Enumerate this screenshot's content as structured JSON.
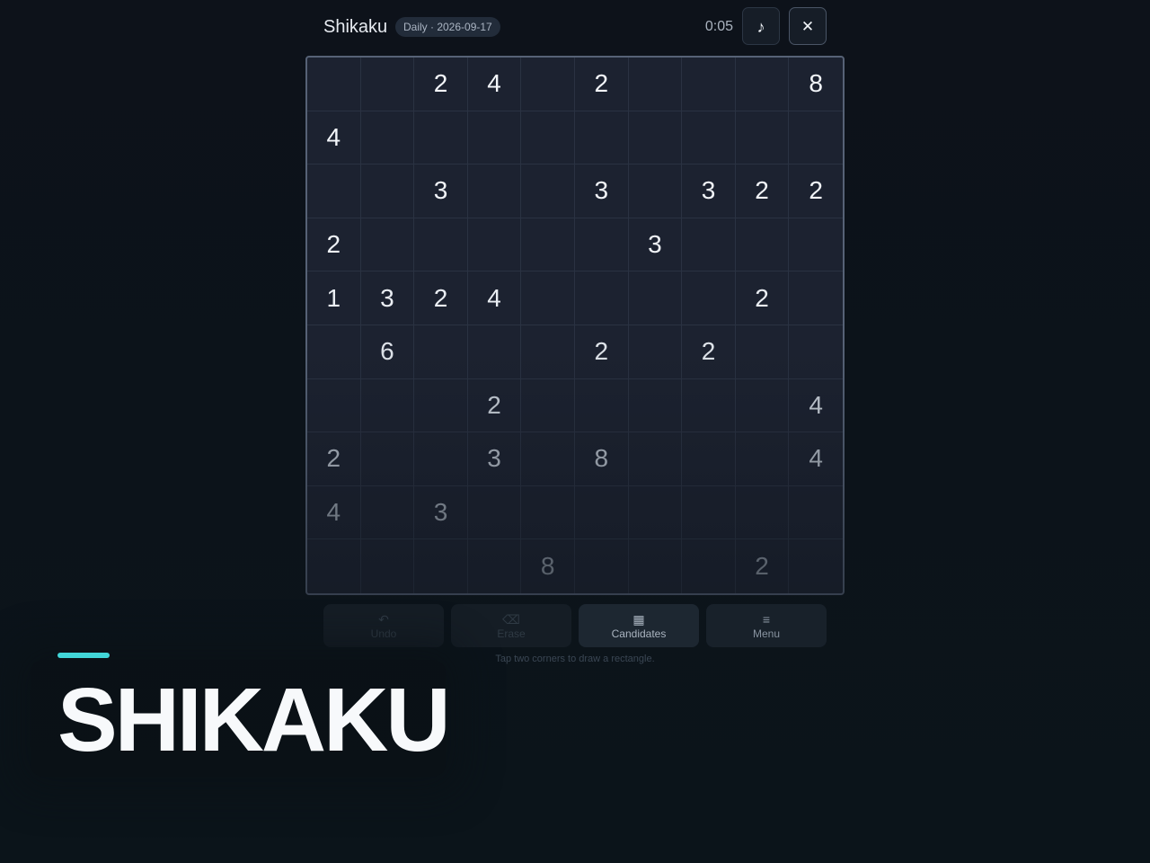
{
  "header": {
    "title": "Shikaku",
    "badge": "Daily · 2026-09-17",
    "timer": "0:05",
    "music_icon": "♪",
    "close_icon": "✕"
  },
  "grid": {
    "rows": 10,
    "cols": 10,
    "cells": [
      [
        "",
        "",
        "2",
        "4",
        "",
        "2",
        "",
        "",
        "",
        "8"
      ],
      [
        "4",
        "",
        "",
        "",
        "",
        "",
        "",
        "",
        "",
        ""
      ],
      [
        "",
        "",
        "3",
        "",
        "",
        "3",
        "",
        "3",
        "2",
        "2"
      ],
      [
        "2",
        "",
        "",
        "",
        "",
        "",
        "3",
        "",
        "",
        ""
      ],
      [
        "1",
        "3",
        "2",
        "4",
        "",
        "",
        "",
        "",
        "2",
        ""
      ],
      [
        "",
        "6",
        "",
        "",
        "",
        "2",
        "",
        "2",
        "",
        ""
      ],
      [
        "",
        "",
        "",
        "2",
        "",
        "",
        "",
        "",
        "",
        "4"
      ],
      [
        "2",
        "",
        "",
        "3",
        "",
        "8",
        "",
        "",
        "",
        "4"
      ],
      [
        "4",
        "",
        "3",
        "",
        "",
        "",
        "",
        "",
        "",
        ""
      ],
      [
        "",
        "",
        "",
        "",
        "8",
        "",
        "",
        "",
        "2",
        ""
      ]
    ]
  },
  "toolbar": {
    "undo": {
      "icon": "↶",
      "label": "Undo"
    },
    "erase": {
      "icon": "⌫",
      "label": "Erase"
    },
    "candidates": {
      "icon": "▦",
      "label": "Candidates"
    },
    "menu": {
      "icon": "≡",
      "label": "Menu"
    }
  },
  "hint": "Tap two corners to draw a rectangle.",
  "brand": "SHIKAKU",
  "colors": {
    "accent": "#41d6d8",
    "background": "#0d121a",
    "board": "#1c2230"
  }
}
